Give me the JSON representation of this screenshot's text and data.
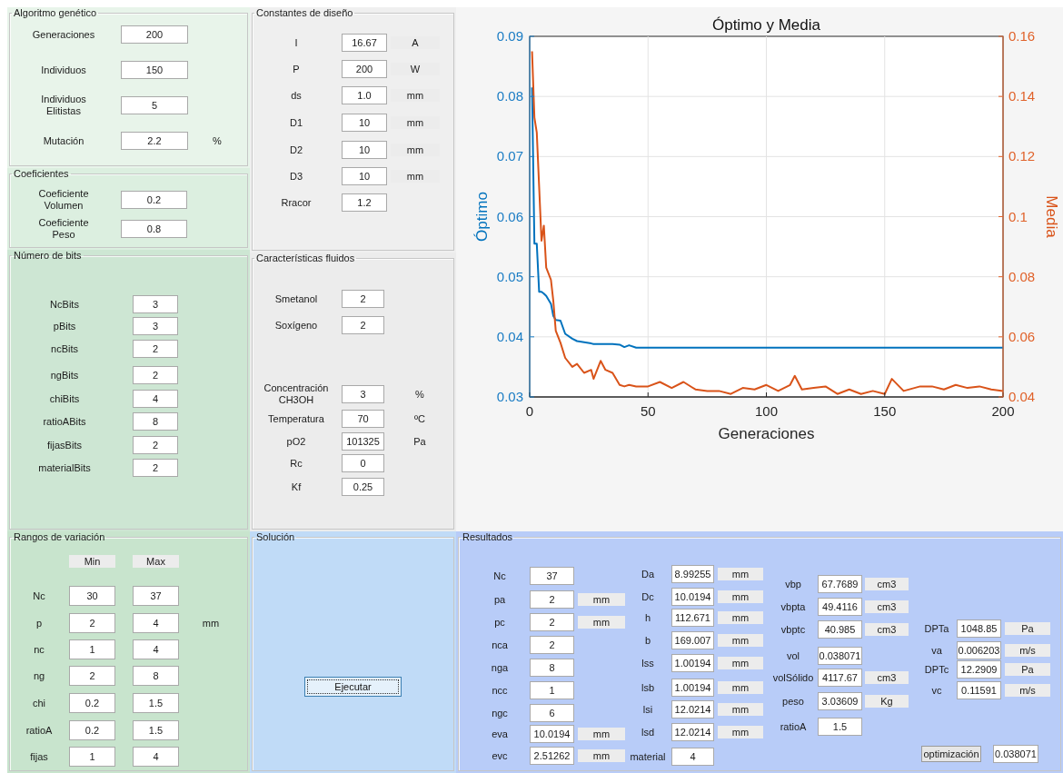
{
  "algoritmo_genetico": {
    "title": "Algoritmo genético",
    "rows": [
      {
        "label": "Generaciones",
        "value": "200"
      },
      {
        "label": "Individuos",
        "value": "150"
      },
      {
        "label": "Individuos\nElitistas",
        "value": "5"
      },
      {
        "label": "Mutación",
        "value": "2.2",
        "unit": "%"
      }
    ]
  },
  "coeficientes": {
    "title": "Coeficientes",
    "rows": [
      {
        "label": "Coeficiente\nVolumen",
        "value": "0.2"
      },
      {
        "label": "Coeficiente\nPeso",
        "value": "0.8"
      }
    ]
  },
  "numero_de_bits": {
    "title": "Número de bits",
    "rows": [
      {
        "label": "NcBits",
        "value": "3"
      },
      {
        "label": "pBits",
        "value": "3"
      },
      {
        "label": "ncBits",
        "value": "2"
      },
      {
        "label": "ngBits",
        "value": "2"
      },
      {
        "label": "chiBits",
        "value": "4"
      },
      {
        "label": "ratioABits",
        "value": "8"
      },
      {
        "label": "fijasBits",
        "value": "2"
      },
      {
        "label": "materialBits",
        "value": "2"
      }
    ]
  },
  "rangos_de_variacion": {
    "title": "Rangos de variación",
    "headers": [
      "Min",
      "Max"
    ],
    "rows": [
      {
        "label": "Nc",
        "min": "30",
        "max": "37"
      },
      {
        "label": "p",
        "min": "2",
        "max": "4",
        "unit": "mm"
      },
      {
        "label": "nc",
        "min": "1",
        "max": "4"
      },
      {
        "label": "ng",
        "min": "2",
        "max": "8"
      },
      {
        "label": "chi",
        "min": "0.2",
        "max": "1.5"
      },
      {
        "label": "ratioA",
        "min": "0.2",
        "max": "1.5"
      },
      {
        "label": "fijas",
        "min": "1",
        "max": "4"
      }
    ]
  },
  "constantes_de_diseno": {
    "title": "Constantes de diseño",
    "rows": [
      {
        "label": "I",
        "value": "16.67",
        "unit": "A"
      },
      {
        "label": "P",
        "value": "200",
        "unit": "W"
      },
      {
        "label": "ds",
        "value": "1.0",
        "unit": "mm"
      },
      {
        "label": "D1",
        "value": "10",
        "unit": "mm"
      },
      {
        "label": "D2",
        "value": "10",
        "unit": "mm"
      },
      {
        "label": "D3",
        "value": "10",
        "unit": "mm"
      },
      {
        "label": "Rracor",
        "value": "1.2"
      }
    ]
  },
  "caracteristicas_fluidos": {
    "title": "Características fluidos",
    "rows": [
      {
        "label": "Smetanol",
        "value": "2"
      },
      {
        "label": "Soxígeno",
        "value": "2"
      },
      {
        "label": "Concentración\nCH3OH",
        "value": "3",
        "unit": "%"
      },
      {
        "label": "Temperatura",
        "value": "70",
        "unit": "ºC"
      },
      {
        "label": "pO2",
        "value": "101325",
        "unit": "Pa"
      },
      {
        "label": "Rc",
        "value": "0"
      },
      {
        "label": "Kf",
        "value": "0.25"
      }
    ]
  },
  "chart": {
    "chart_data": {
      "type": "line",
      "title": "Óptimo y Media",
      "xlabel": "Generaciones",
      "ylabel": "Óptimo",
      "y2label": "Media",
      "x": [
        1,
        2,
        3,
        4,
        5,
        6,
        7,
        9,
        10,
        11,
        13,
        15,
        18,
        20,
        23,
        26,
        27,
        30,
        32,
        35,
        38,
        40,
        42,
        45,
        50,
        55,
        60,
        65,
        70,
        75,
        80,
        85,
        90,
        95,
        100,
        105,
        110,
        112,
        115,
        120,
        125,
        130,
        135,
        140,
        145,
        150,
        153,
        158,
        165,
        170,
        175,
        180,
        185,
        190,
        195,
        200
      ],
      "grid": true,
      "xlim": [
        0,
        200
      ],
      "ylim": [
        0.03,
        0.09
      ],
      "y2lim": [
        0.04,
        0.16
      ],
      "xticks": [
        0,
        50,
        100,
        150,
        200
      ],
      "yticks": [
        0.03,
        0.04,
        0.05,
        0.06,
        0.07,
        0.08,
        0.09
      ],
      "y2ticks": [
        0.04,
        0.06,
        0.08,
        0.1,
        0.12,
        0.14,
        0.16
      ],
      "series": [
        {
          "color": "#0072bd",
          "values": [
            0.0815,
            0.0555,
            0.0555,
            0.0475,
            0.0475,
            0.0472,
            0.0468,
            0.0455,
            0.0435,
            0.0428,
            0.0427,
            0.0405,
            0.0397,
            0.0393,
            0.0391,
            0.0389,
            0.0388,
            0.0388,
            0.0388,
            0.0388,
            0.0387,
            0.0383,
            0.0386,
            0.0382,
            0.0382,
            0.0382,
            0.0382,
            0.0382,
            0.0382,
            0.0382,
            0.0382,
            0.0382,
            0.0382,
            0.0382,
            0.0382,
            0.0382,
            0.0382,
            0.0382,
            0.0382,
            0.0382,
            0.0382,
            0.0382,
            0.0382,
            0.0382,
            0.0382,
            0.0382,
            0.0382,
            0.0382,
            0.0382,
            0.0382,
            0.0382,
            0.0382,
            0.0382,
            0.0382,
            0.0382,
            0.0382
          ]
        },
        {
          "color": "#d95319",
          "axis": "y2",
          "values": [
            0.155,
            0.133,
            0.128,
            0.11,
            0.092,
            0.097,
            0.083,
            0.079,
            0.072,
            0.062,
            0.058,
            0.053,
            0.05,
            0.051,
            0.048,
            0.049,
            0.046,
            0.052,
            0.049,
            0.048,
            0.044,
            0.0435,
            0.044,
            0.0435,
            0.0435,
            0.045,
            0.043,
            0.045,
            0.0425,
            0.042,
            0.042,
            0.041,
            0.043,
            0.0425,
            0.044,
            0.042,
            0.044,
            0.047,
            0.0425,
            0.043,
            0.0435,
            0.041,
            0.0425,
            0.041,
            0.042,
            0.041,
            0.046,
            0.042,
            0.0435,
            0.0435,
            0.0425,
            0.044,
            0.043,
            0.0435,
            0.0425,
            0.042
          ]
        }
      ]
    }
  },
  "solucion": {
    "title": "Solución",
    "button": "Ejecutar"
  },
  "resultados": {
    "title": "Resultados",
    "columns": [
      {
        "rows": [
          {
            "label": "Nc",
            "value": "37"
          },
          {
            "label": "pa",
            "value": "2",
            "unit": "mm"
          },
          {
            "label": "pc",
            "value": "2",
            "unit": "mm"
          },
          {
            "label": "nca",
            "value": "2"
          },
          {
            "label": "nga",
            "value": "8"
          },
          {
            "label": "ncc",
            "value": "1"
          },
          {
            "label": "ngc",
            "value": "6"
          },
          {
            "label": "eva",
            "value": "10.0194",
            "unit": "mm"
          },
          {
            "label": "evc",
            "value": "2.51262",
            "unit": "mm"
          }
        ]
      },
      {
        "rows": [
          {
            "label": "Da",
            "value": "8.99255",
            "unit": "mm"
          },
          {
            "label": "Dc",
            "value": "10.0194",
            "unit": "mm"
          },
          {
            "label": "h",
            "value": "112.671",
            "unit": "mm"
          },
          {
            "label": "b",
            "value": "169.007",
            "unit": "mm"
          },
          {
            "label": "lss",
            "value": "1.00194",
            "unit": "mm"
          },
          {
            "label": "lsb",
            "value": "1.00194",
            "unit": "mm"
          },
          {
            "label": "lsi",
            "value": "12.0214",
            "unit": "mm"
          },
          {
            "label": "lsd",
            "value": "12.0214",
            "unit": "mm"
          },
          {
            "label": "material",
            "value": "4"
          }
        ]
      },
      {
        "rows": [
          {
            "label": "vbp",
            "value": "67.7689",
            "unit": "cm3"
          },
          {
            "label": "vbpta",
            "value": "49.4116",
            "unit": "cm3"
          },
          {
            "label": "vbptc",
            "value": "40.985",
            "unit": "cm3"
          },
          {
            "label": "vol",
            "value": "0.038071"
          },
          {
            "label": "volSólido",
            "value": "4117.67",
            "unit": "cm3"
          },
          {
            "label": "peso",
            "value": "3.03609",
            "unit": "Kg"
          },
          {
            "label": "ratioA",
            "value": "1.5"
          }
        ]
      },
      {
        "rows": [
          {
            "label": "DPTa",
            "value": "1048.85",
            "unit": "Pa"
          },
          {
            "label": "va",
            "value": "0.006203",
            "unit": "m/s"
          },
          {
            "label": "DPTc",
            "value": "12.2909",
            "unit": "Pa"
          },
          {
            "label": "vc",
            "value": "0.11591",
            "unit": "m/s"
          }
        ]
      }
    ],
    "optimizacion": {
      "label": "optimización",
      "value": "0.038071"
    }
  }
}
